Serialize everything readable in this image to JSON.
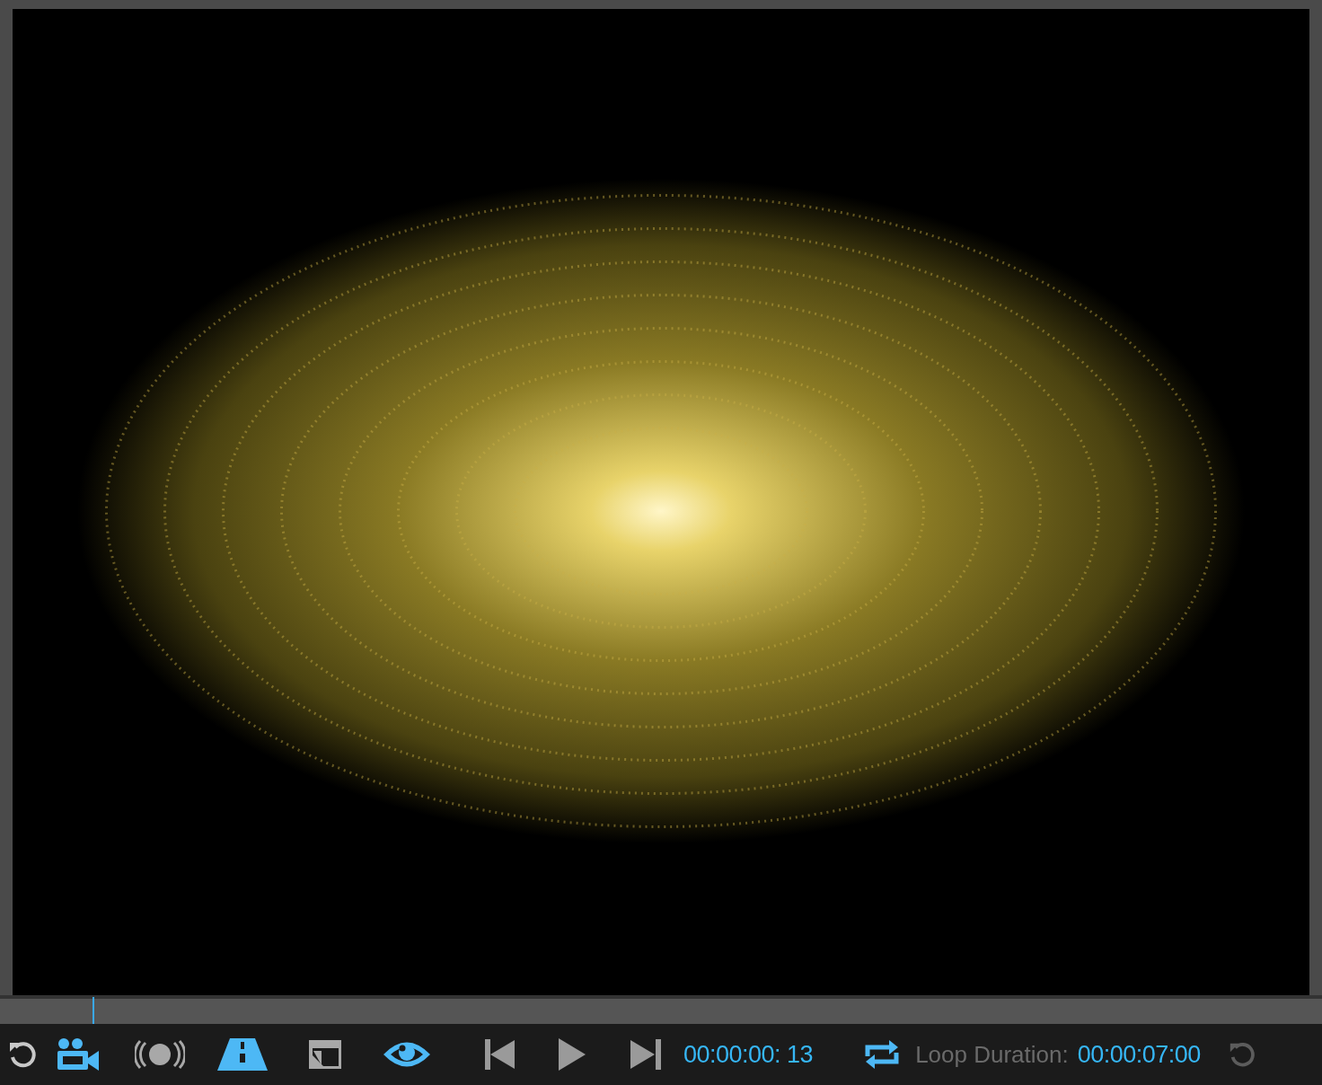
{
  "timeline": {
    "level": 0.07
  },
  "toolbar": {
    "tools": [
      {
        "kind": "reset",
        "on": false
      },
      {
        "kind": "camera",
        "on": true
      },
      {
        "kind": "emitter",
        "on": false
      },
      {
        "kind": "ground",
        "on": true
      },
      {
        "kind": "panel",
        "on": false
      },
      {
        "kind": "eye",
        "on": true
      }
    ],
    "transport": [
      {
        "kind": "first"
      },
      {
        "kind": "play"
      },
      {
        "kind": "last"
      }
    ],
    "timecode": "00:00:00: 13",
    "loop": {
      "on": true,
      "label": "Loop Duration:",
      "value": "00:00:07:00"
    },
    "reset_loop": {
      "disabled": true
    }
  }
}
